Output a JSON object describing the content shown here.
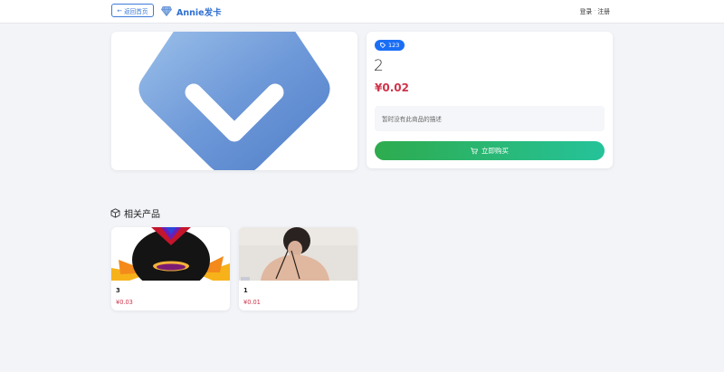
{
  "nav": {
    "back_label": "返回首页",
    "brand_name": "Annie发卡",
    "login": "登录",
    "separator": "·",
    "register": "注册"
  },
  "product": {
    "tag": "123",
    "title": "2",
    "price": "¥0.02",
    "description": "暂时没有此商品的描述",
    "buy_label": "立即购买",
    "image_icon": "chevron-down-badge-icon"
  },
  "related": {
    "heading": "相关产品",
    "items": [
      {
        "name": "3",
        "price": "¥0.03"
      },
      {
        "name": "1",
        "price": "¥0.01"
      }
    ]
  },
  "colors": {
    "primary": "#1a6ef5",
    "brand": "#2f6fd1",
    "price": "#d0334a",
    "buy_start": "#2eab4e",
    "buy_end": "#25c39a"
  }
}
